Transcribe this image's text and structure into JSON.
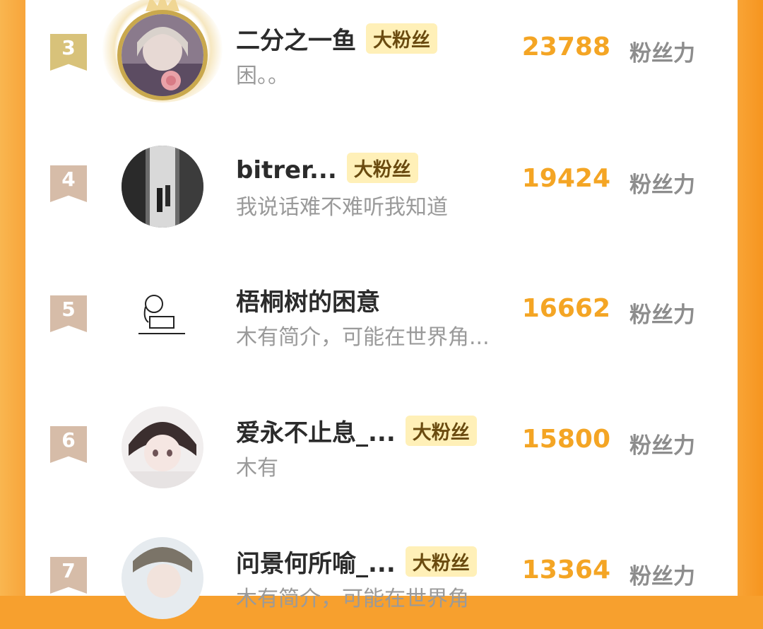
{
  "ranking": {
    "rows": [
      {
        "rank": "3",
        "name": "二分之一鱼",
        "badge": "大粉丝",
        "bio": "困。。",
        "score": "23788",
        "unit": "粉丝力"
      },
      {
        "rank": "4",
        "name": "bitrer...",
        "badge": "大粉丝",
        "bio": "我说话难不难听我知道",
        "score": "19424",
        "unit": "粉丝力"
      },
      {
        "rank": "5",
        "name": "梧桐树的困意",
        "badge": "",
        "bio": "木有简介，可能在世界角...",
        "score": "16662",
        "unit": "粉丝力"
      },
      {
        "rank": "6",
        "name": "爱永不止息_...",
        "badge": "大粉丝",
        "bio": "木有",
        "score": "15800",
        "unit": "粉丝力"
      },
      {
        "rank": "7",
        "name": "问景何所喻_...",
        "badge": "大粉丝",
        "bio": "木有简介，可能在世界角",
        "score": "13364",
        "unit": "粉丝力"
      }
    ]
  },
  "colors": {
    "frame": "#f7a02e",
    "score": "#f4a524",
    "badge_bg": "#fff0b8",
    "rank_gold": "#d8c27a",
    "rank_default": "#d6bca8"
  },
  "icons": {
    "rank_ribbon": "ribbon-icon",
    "avatar_frame": "crown-wings-frame-icon"
  }
}
